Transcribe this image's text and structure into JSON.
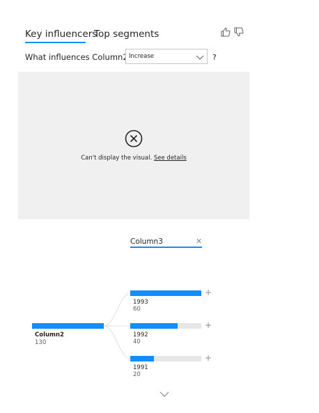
{
  "tabs": {
    "key_influencers": "Key influencers",
    "top_segments": "Top segments"
  },
  "feedback": {
    "thumbs_up_icon": "thumbs-up-icon",
    "thumbs_down_icon": "thumbs-down-icon"
  },
  "question": {
    "text": "What influences Column2 to",
    "selected": "Increase",
    "help": "?"
  },
  "error": {
    "message": "Can't display the visual.",
    "link": "See details"
  },
  "field": {
    "label": "Column3",
    "clear": "✕"
  },
  "tree": {
    "root": {
      "label": "Column2",
      "count": "130",
      "value": 130
    },
    "children": [
      {
        "label": "1993",
        "count": "60",
        "fraction": 1.0
      },
      {
        "label": "1992",
        "count": "40",
        "fraction": 0.667
      },
      {
        "label": "1991",
        "count": "20",
        "fraction": 0.333
      }
    ],
    "plus": "+"
  },
  "colors": {
    "accent": "#118dff",
    "panel": "#f0f0f0",
    "track": "#e6e6e6"
  }
}
